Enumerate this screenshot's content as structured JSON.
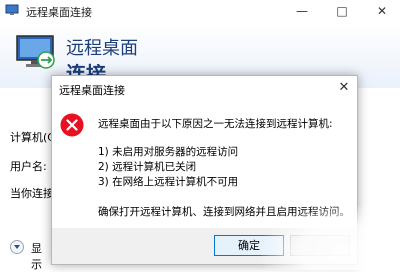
{
  "window": {
    "title": "远程桌面连接",
    "minimize_glyph": "—",
    "maximize_glyph": "□",
    "close_glyph": "✕"
  },
  "banner": {
    "line1": "远程桌面",
    "line2": "连接",
    "icon": "remote-desktop-monitor-icon"
  },
  "form": {
    "computer_label": "计算机(C",
    "user_label": "用户名:",
    "prompt_label": "当你连接",
    "show_options_label": "显示"
  },
  "dialog": {
    "title": "远程桌面连接",
    "close_glyph": "✕",
    "icon": "error-icon",
    "message_head": "远程桌面由于以下原因之一无法连接到远程计算机:",
    "reasons": [
      "1) 未启用对服务器的远程访问",
      "2) 远程计算机已关闭",
      "3) 在网络上远程计算机不可用"
    ],
    "message_foot": "确保打开远程计算机、连接到网络并且启用远程访问。",
    "ok_label": "确定"
  },
  "colors": {
    "accent": "#0078d7",
    "banner_text": "#1d3f7a",
    "error_red": "#e81123"
  }
}
